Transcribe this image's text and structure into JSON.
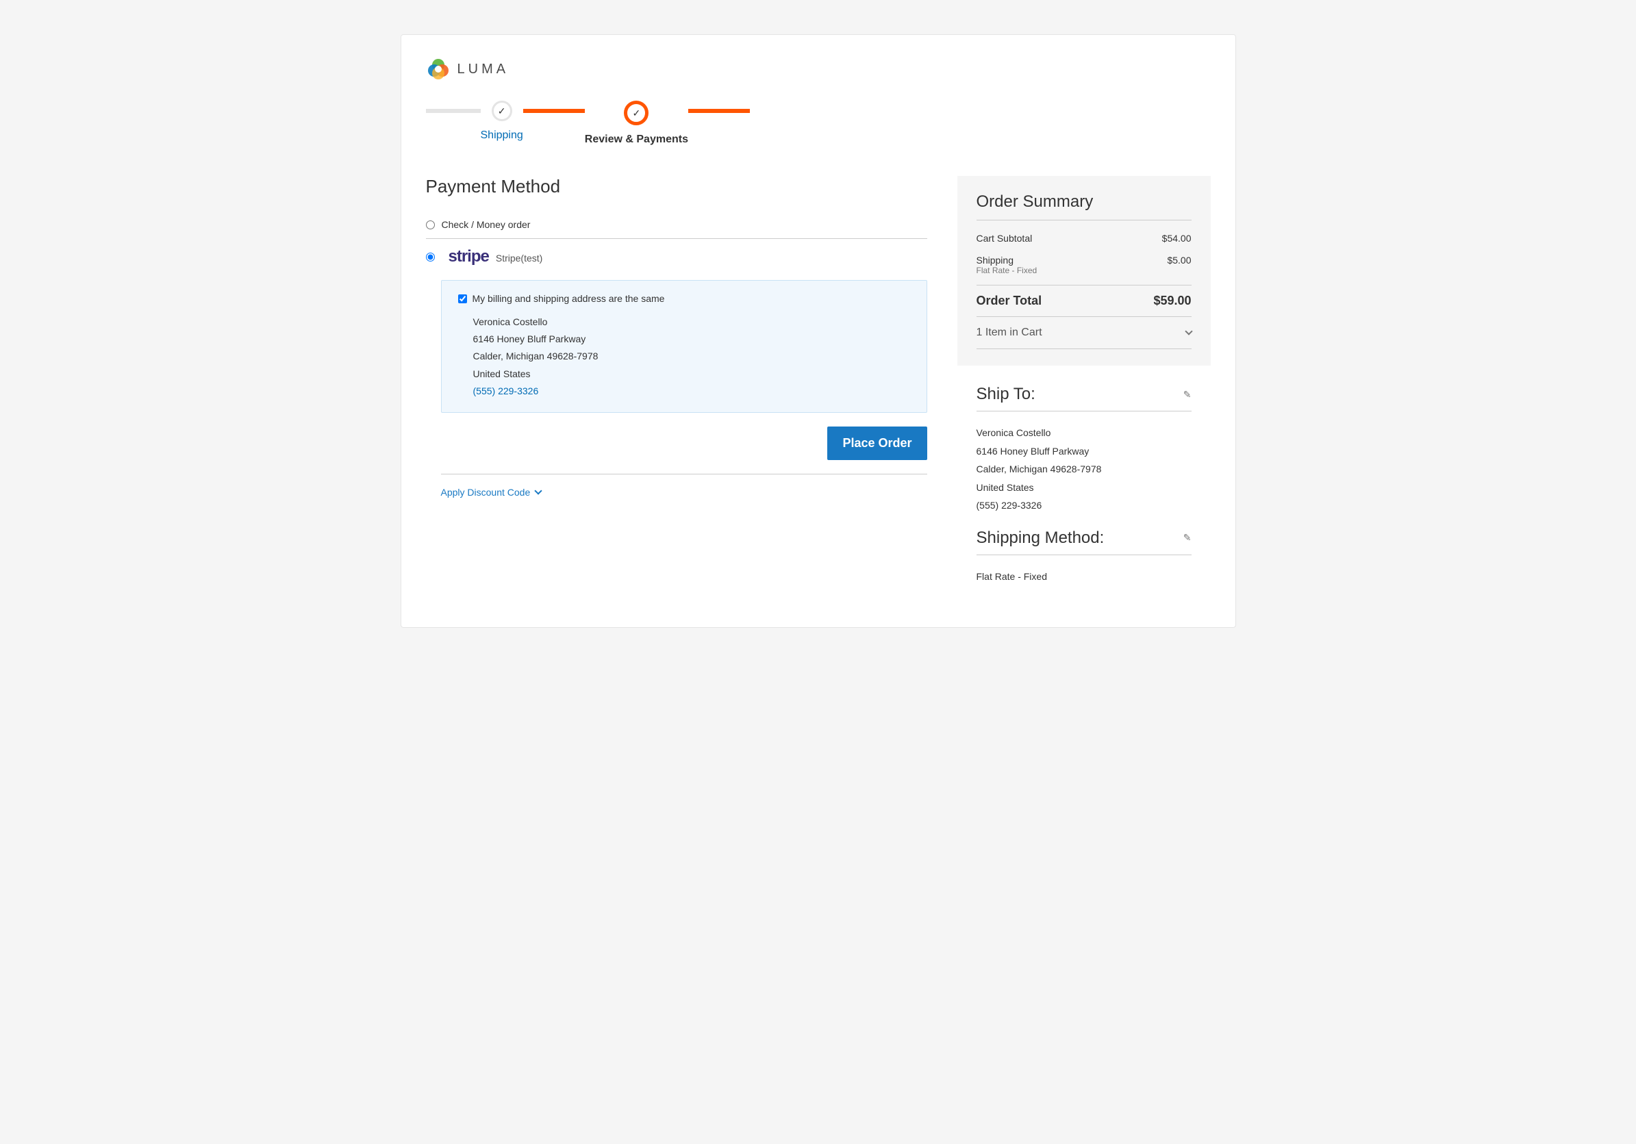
{
  "brand": "LUMA",
  "progress": {
    "step1": "Shipping",
    "step2": "Review & Payments"
  },
  "payment": {
    "heading": "Payment Method",
    "options": {
      "check_money": "Check / Money order",
      "stripe_logo": "stripe",
      "stripe_label": "Stripe(test)"
    },
    "billing_same_label": "My billing and shipping address are the same",
    "billing_address": {
      "name": "Veronica Costello",
      "street": "6146 Honey Bluff Parkway",
      "city_state_zip": "Calder, Michigan 49628-7978",
      "country": "United States",
      "phone": "(555) 229-3326"
    },
    "place_order_button": "Place Order",
    "discount_link": "Apply Discount Code"
  },
  "summary": {
    "title": "Order Summary",
    "subtotal_label": "Cart Subtotal",
    "subtotal_value": "$54.00",
    "shipping_label": "Shipping",
    "shipping_method_note": "Flat Rate - Fixed",
    "shipping_value": "$5.00",
    "total_label": "Order Total",
    "total_value": "$59.00",
    "items_in_cart": "1 Item in Cart"
  },
  "ship_to": {
    "title": "Ship To:",
    "name": "Veronica Costello",
    "street": "6146 Honey Bluff Parkway",
    "city_state_zip": "Calder, Michigan 49628-7978",
    "country": "United States",
    "phone": "(555) 229-3326"
  },
  "shipping_method": {
    "title": "Shipping Method:",
    "value": "Flat Rate - Fixed"
  }
}
